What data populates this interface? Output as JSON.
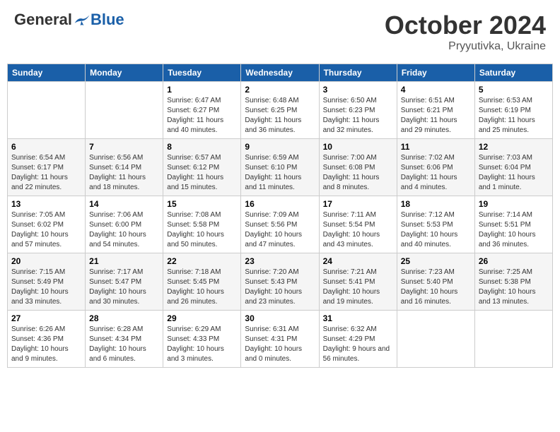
{
  "header": {
    "logo_general": "General",
    "logo_blue": "Blue",
    "month_title": "October 2024",
    "location": "Pryyutivka, Ukraine"
  },
  "weekdays": [
    "Sunday",
    "Monday",
    "Tuesday",
    "Wednesday",
    "Thursday",
    "Friday",
    "Saturday"
  ],
  "weeks": [
    [
      {
        "day": "",
        "info": ""
      },
      {
        "day": "",
        "info": ""
      },
      {
        "day": "1",
        "info": "Sunrise: 6:47 AM\nSunset: 6:27 PM\nDaylight: 11 hours and 40 minutes."
      },
      {
        "day": "2",
        "info": "Sunrise: 6:48 AM\nSunset: 6:25 PM\nDaylight: 11 hours and 36 minutes."
      },
      {
        "day": "3",
        "info": "Sunrise: 6:50 AM\nSunset: 6:23 PM\nDaylight: 11 hours and 32 minutes."
      },
      {
        "day": "4",
        "info": "Sunrise: 6:51 AM\nSunset: 6:21 PM\nDaylight: 11 hours and 29 minutes."
      },
      {
        "day": "5",
        "info": "Sunrise: 6:53 AM\nSunset: 6:19 PM\nDaylight: 11 hours and 25 minutes."
      }
    ],
    [
      {
        "day": "6",
        "info": "Sunrise: 6:54 AM\nSunset: 6:17 PM\nDaylight: 11 hours and 22 minutes."
      },
      {
        "day": "7",
        "info": "Sunrise: 6:56 AM\nSunset: 6:14 PM\nDaylight: 11 hours and 18 minutes."
      },
      {
        "day": "8",
        "info": "Sunrise: 6:57 AM\nSunset: 6:12 PM\nDaylight: 11 hours and 15 minutes."
      },
      {
        "day": "9",
        "info": "Sunrise: 6:59 AM\nSunset: 6:10 PM\nDaylight: 11 hours and 11 minutes."
      },
      {
        "day": "10",
        "info": "Sunrise: 7:00 AM\nSunset: 6:08 PM\nDaylight: 11 hours and 8 minutes."
      },
      {
        "day": "11",
        "info": "Sunrise: 7:02 AM\nSunset: 6:06 PM\nDaylight: 11 hours and 4 minutes."
      },
      {
        "day": "12",
        "info": "Sunrise: 7:03 AM\nSunset: 6:04 PM\nDaylight: 11 hours and 1 minute."
      }
    ],
    [
      {
        "day": "13",
        "info": "Sunrise: 7:05 AM\nSunset: 6:02 PM\nDaylight: 10 hours and 57 minutes."
      },
      {
        "day": "14",
        "info": "Sunrise: 7:06 AM\nSunset: 6:00 PM\nDaylight: 10 hours and 54 minutes."
      },
      {
        "day": "15",
        "info": "Sunrise: 7:08 AM\nSunset: 5:58 PM\nDaylight: 10 hours and 50 minutes."
      },
      {
        "day": "16",
        "info": "Sunrise: 7:09 AM\nSunset: 5:56 PM\nDaylight: 10 hours and 47 minutes."
      },
      {
        "day": "17",
        "info": "Sunrise: 7:11 AM\nSunset: 5:54 PM\nDaylight: 10 hours and 43 minutes."
      },
      {
        "day": "18",
        "info": "Sunrise: 7:12 AM\nSunset: 5:53 PM\nDaylight: 10 hours and 40 minutes."
      },
      {
        "day": "19",
        "info": "Sunrise: 7:14 AM\nSunset: 5:51 PM\nDaylight: 10 hours and 36 minutes."
      }
    ],
    [
      {
        "day": "20",
        "info": "Sunrise: 7:15 AM\nSunset: 5:49 PM\nDaylight: 10 hours and 33 minutes."
      },
      {
        "day": "21",
        "info": "Sunrise: 7:17 AM\nSunset: 5:47 PM\nDaylight: 10 hours and 30 minutes."
      },
      {
        "day": "22",
        "info": "Sunrise: 7:18 AM\nSunset: 5:45 PM\nDaylight: 10 hours and 26 minutes."
      },
      {
        "day": "23",
        "info": "Sunrise: 7:20 AM\nSunset: 5:43 PM\nDaylight: 10 hours and 23 minutes."
      },
      {
        "day": "24",
        "info": "Sunrise: 7:21 AM\nSunset: 5:41 PM\nDaylight: 10 hours and 19 minutes."
      },
      {
        "day": "25",
        "info": "Sunrise: 7:23 AM\nSunset: 5:40 PM\nDaylight: 10 hours and 16 minutes."
      },
      {
        "day": "26",
        "info": "Sunrise: 7:25 AM\nSunset: 5:38 PM\nDaylight: 10 hours and 13 minutes."
      }
    ],
    [
      {
        "day": "27",
        "info": "Sunrise: 6:26 AM\nSunset: 4:36 PM\nDaylight: 10 hours and 9 minutes."
      },
      {
        "day": "28",
        "info": "Sunrise: 6:28 AM\nSunset: 4:34 PM\nDaylight: 10 hours and 6 minutes."
      },
      {
        "day": "29",
        "info": "Sunrise: 6:29 AM\nSunset: 4:33 PM\nDaylight: 10 hours and 3 minutes."
      },
      {
        "day": "30",
        "info": "Sunrise: 6:31 AM\nSunset: 4:31 PM\nDaylight: 10 hours and 0 minutes."
      },
      {
        "day": "31",
        "info": "Sunrise: 6:32 AM\nSunset: 4:29 PM\nDaylight: 9 hours and 56 minutes."
      },
      {
        "day": "",
        "info": ""
      },
      {
        "day": "",
        "info": ""
      }
    ]
  ]
}
